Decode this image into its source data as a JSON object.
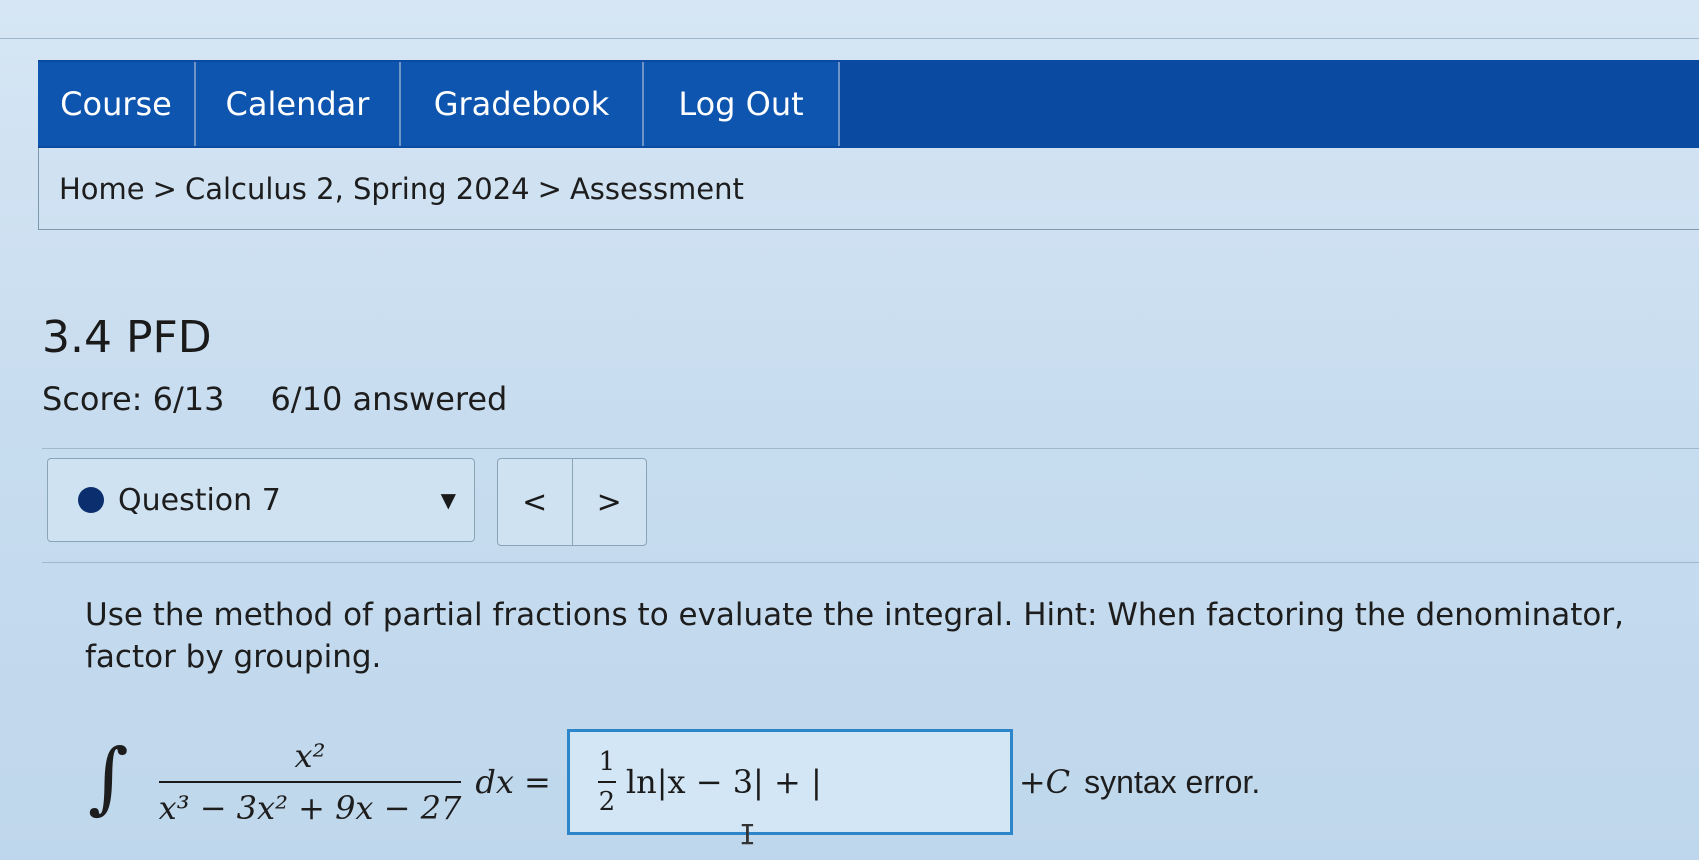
{
  "nav": {
    "tabs": [
      {
        "label": "Course"
      },
      {
        "label": "Calendar"
      },
      {
        "label": "Gradebook"
      },
      {
        "label": "Log Out"
      }
    ]
  },
  "breadcrumb": {
    "home": "Home",
    "course": "Calculus 2, Spring 2024",
    "page": "Assessment",
    "separator": ">"
  },
  "assessment": {
    "title": "3.4 PFD",
    "score": "Score: 6/13",
    "answered": "6/10 answered"
  },
  "question_nav": {
    "selected": "Question 7",
    "prev_symbol": "<",
    "next_symbol": ">"
  },
  "problem": {
    "prompt": "Use the method of partial fractions to evaluate the integral. Hint: When factoring the denominator, factor by grouping.",
    "integral_symbol": "∫",
    "numerator": "x²",
    "denominator": "x³ − 3x² + 9x − 27",
    "dx": "dx =",
    "answer_frac_num": "1",
    "answer_frac_den": "2",
    "answer_value": "ln|x − 3| + |",
    "plus_c": "+C",
    "status": "syntax error."
  },
  "colors": {
    "nav_bg": "#0a4aa0",
    "answer_border": "#2c86c9",
    "status_dot": "#0b2f6e"
  }
}
